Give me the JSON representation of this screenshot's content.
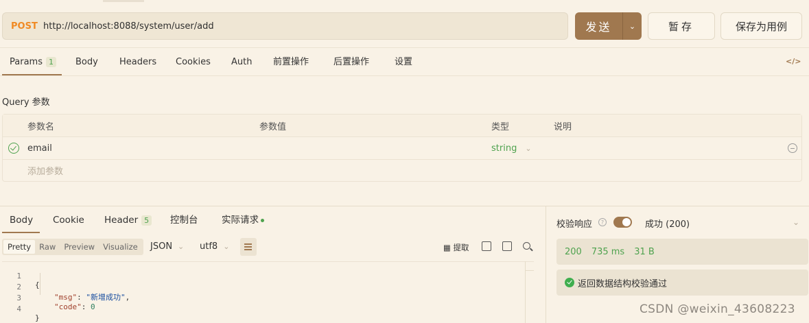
{
  "request": {
    "method": "POST",
    "url": "http://localhost:8088/system/user/add",
    "send_label": "发送",
    "save_label": "暂存",
    "save_as_label": "保存为用例"
  },
  "request_tabs": [
    {
      "label": "Params",
      "badge": "1",
      "active": true
    },
    {
      "label": "Body"
    },
    {
      "label": "Headers"
    },
    {
      "label": "Cookies"
    },
    {
      "label": "Auth"
    },
    {
      "label": "前置操作"
    },
    {
      "label": "后置操作"
    },
    {
      "label": "设置"
    }
  ],
  "code_toggle_label": "</>",
  "query": {
    "section_label": "Query 参数",
    "columns": [
      "参数名",
      "参数值",
      "类型",
      "说明"
    ],
    "rows": [
      {
        "name": "email",
        "value": "",
        "type": "string",
        "description": ""
      }
    ],
    "add_placeholder": "添加参数"
  },
  "response_tabs": [
    {
      "label": "Body",
      "active": true
    },
    {
      "label": "Cookie"
    },
    {
      "label": "Header",
      "badge": "5"
    },
    {
      "label": "控制台"
    },
    {
      "label": "实际请求"
    }
  ],
  "format_buttons": [
    "Pretty",
    "Raw",
    "Preview",
    "Visualize"
  ],
  "format_active": "Pretty",
  "format_select": "JSON",
  "encoding_select": "utf8",
  "extract_label": "提取",
  "code_lines": [
    {
      "no": "1",
      "text": "{"
    },
    {
      "no": "2",
      "key": "\"msg\"",
      "value": "\"新增成功\""
    },
    {
      "no": "3",
      "key": "\"code\"",
      "value": "0"
    },
    {
      "no": "4",
      "text": "}"
    }
  ],
  "validation": {
    "label": "校验响应",
    "enabled": true,
    "result_select": "成功 (200)",
    "status": "200",
    "time": "735 ms",
    "size": "31 B",
    "message": "返回数据结构校验通过"
  },
  "watermark": "CSDN @weixin_43608223",
  "colors": {
    "accent": "#a0784f",
    "method": "#f08a24",
    "success": "#4ea24e",
    "background": "#f9f2e6"
  }
}
